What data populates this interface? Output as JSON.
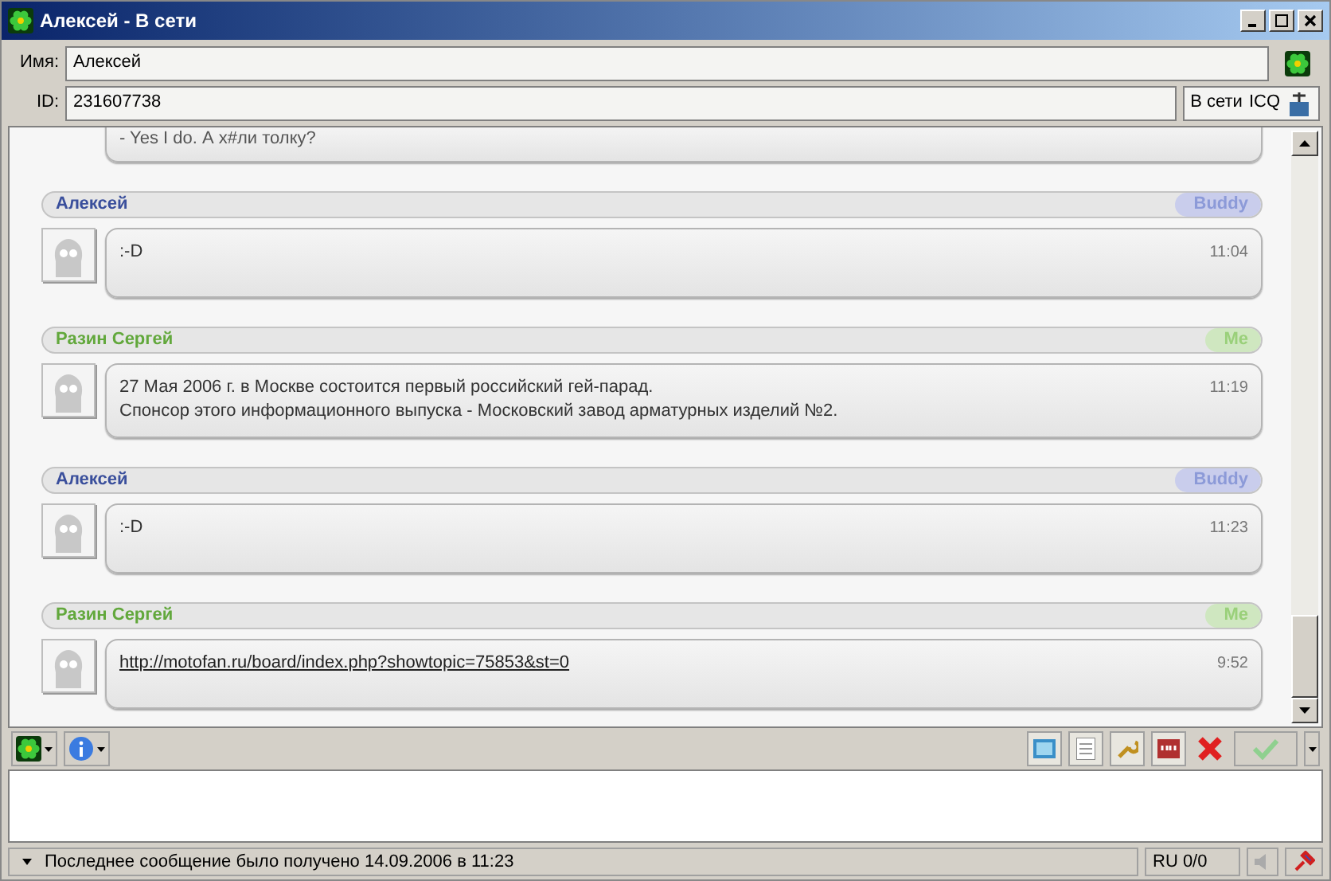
{
  "window": {
    "title": "Алексей - В сети"
  },
  "contact": {
    "name_label": "Имя:",
    "name": "Алексей",
    "id_label": "ID:",
    "id": "231607738",
    "status": "В сети",
    "network": "ICQ"
  },
  "partial_message": {
    "text": "- Yes I do. А х#ли толку?"
  },
  "messages": [
    {
      "sender": "Алексей",
      "kind": "buddy",
      "tag": "Buddy",
      "time": "11:04",
      "is_link": false,
      "lines": [
        ":-D"
      ]
    },
    {
      "sender": "Разин Сергей",
      "kind": "me",
      "tag": "Me",
      "time": "11:19",
      "is_link": false,
      "lines": [
        "27 Мая 2006 г. в Москве состоится первый российский гей-парад.",
        "Спонсор этого информационного выпуска - Московский завод арматурных изделий №2."
      ]
    },
    {
      "sender": "Алексей",
      "kind": "buddy",
      "tag": "Buddy",
      "time": "11:23",
      "is_link": false,
      "lines": [
        ":-D"
      ]
    },
    {
      "sender": "Разин Сергей",
      "kind": "me",
      "tag": "Me",
      "time": "9:52",
      "is_link": true,
      "lines": [
        "http://motofan.ru/board/index.php?showtopic=75853&st=0"
      ]
    }
  ],
  "status_bar": {
    "text": "Последнее сообщение было получено 14.09.2006 в 11:23",
    "keyboard": "RU 0/0"
  }
}
